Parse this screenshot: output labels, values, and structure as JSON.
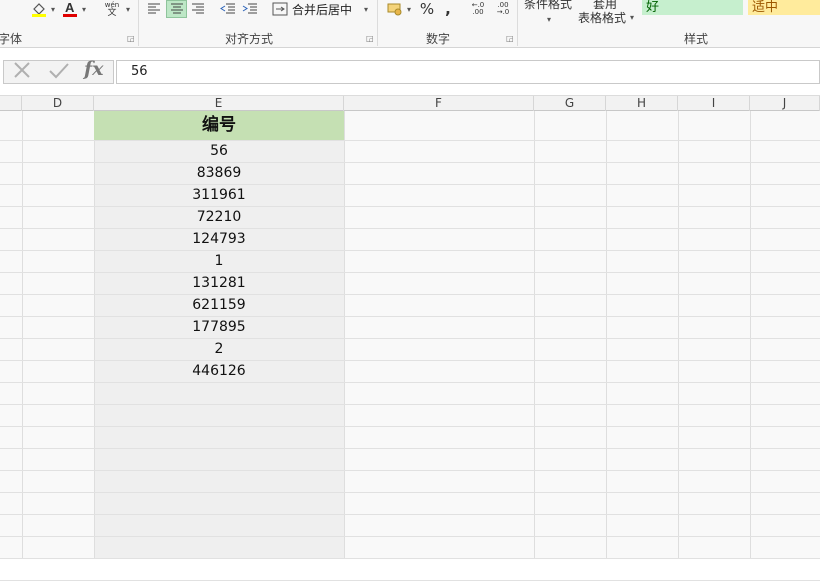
{
  "ribbon": {
    "font_group_label": "字体",
    "align_group_label": "对齐方式",
    "merge_label": "合并后居中",
    "number_group_label": "数字",
    "percent_label": "%",
    "comma_label": ",",
    "cond_format_label": "条件格式",
    "table_format_line1": "套用",
    "table_format_line2": "表格格式",
    "styles_group_label": "样式",
    "style_good_label": "好",
    "style_neutral_label": "适中",
    "wen_label": "wén",
    "wen_char": "文",
    "decimal_inc_label": "←.0 .00",
    "decimal_dec_label": ".00 →.0",
    "colors": {
      "good_bg": "#c6efce",
      "neutral_bg": "#ffeb9c",
      "font_color_bar": "#e00000",
      "fill_color_bar": "#ffff00",
      "active_align": "#bde7c6"
    }
  },
  "formula_bar": {
    "value": "56",
    "cancel_icon": "x-icon",
    "enter_icon": "check-icon",
    "function_label": "fx"
  },
  "columns": [
    "D",
    "E",
    "F",
    "G",
    "H",
    "I",
    "J"
  ],
  "sheet": {
    "header": "编号",
    "header_color": "#c5e0b3",
    "values": [
      "56",
      "83869",
      "311961",
      "72210",
      "124793",
      "1",
      "131281",
      "621159",
      "177895",
      "2",
      "446126"
    ]
  }
}
